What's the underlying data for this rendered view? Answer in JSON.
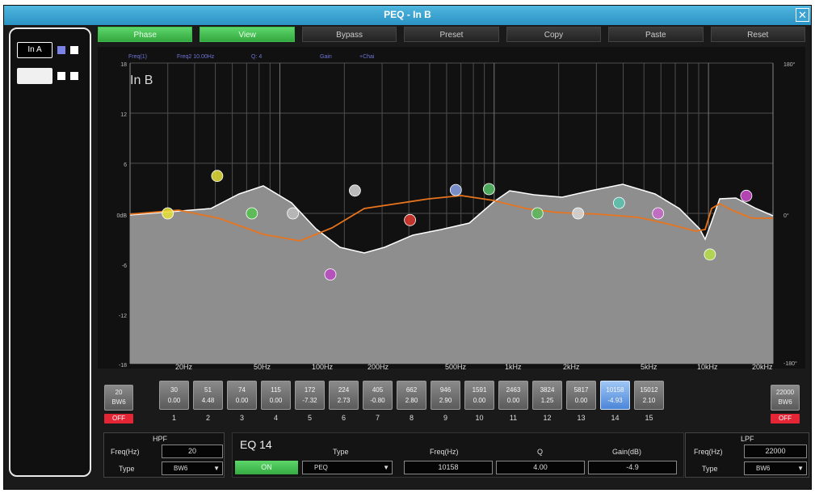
{
  "window": {
    "title": "PEQ - In B",
    "close_label": "✕"
  },
  "channels": [
    {
      "label": "In A",
      "color1": "#7b83e6",
      "color2": "#ffffff"
    },
    {
      "label": "In B",
      "color1": "#ffffff",
      "color2": "#ffffff"
    }
  ],
  "toolbar": {
    "buttons": [
      "Phase",
      "View",
      "Bypass",
      "Preset",
      "Copy",
      "Paste",
      "Reset"
    ],
    "active": [
      true,
      true,
      false,
      false,
      false,
      false,
      false
    ]
  },
  "graph": {
    "channel_name": "In B",
    "top_info": [
      "Freq(1)",
      "Freq2 10.00Hz",
      "Q: 4",
      "Gain",
      "+Chai"
    ],
    "y_ticks": [
      "18",
      "12",
      "6",
      "0dB",
      "-6",
      "-12",
      "-18"
    ],
    "right_ticks": [
      "180°",
      "0°",
      "-180°"
    ],
    "freq_labels": [
      "20Hz",
      "50Hz",
      "100Hz",
      "200Hz",
      "500Hz",
      "1kHz",
      "2kHz",
      "5kHz",
      "10kHz",
      "20kHz"
    ],
    "colors": {
      "fill": "#8e8e8e",
      "curve": "#ffffff",
      "phase": "#e8741e",
      "grid": "#5a5a5a",
      "bg": "#111111"
    }
  },
  "hpf_pass": {
    "value": "20",
    "type": "BW6",
    "off_label": "OFF"
  },
  "lpf_pass": {
    "value": "22000",
    "type": "BW6",
    "off_label": "OFF"
  },
  "bands": [
    {
      "num": "1",
      "freq": "30",
      "gain": "0.00"
    },
    {
      "num": "2",
      "freq": "51",
      "gain": "4.48"
    },
    {
      "num": "3",
      "freq": "74",
      "gain": "0.00"
    },
    {
      "num": "4",
      "freq": "115",
      "gain": "0.00"
    },
    {
      "num": "5",
      "freq": "172",
      "gain": "-7.32"
    },
    {
      "num": "6",
      "freq": "224",
      "gain": "2.73"
    },
    {
      "num": "7",
      "freq": "405",
      "gain": "-0.80"
    },
    {
      "num": "8",
      "freq": "662",
      "gain": "2.80"
    },
    {
      "num": "9",
      "freq": "946",
      "gain": "2.90"
    },
    {
      "num": "10",
      "freq": "1591",
      "gain": "0.00"
    },
    {
      "num": "11",
      "freq": "2463",
      "gain": "0.00"
    },
    {
      "num": "12",
      "freq": "3824",
      "gain": "1.25"
    },
    {
      "num": "13",
      "freq": "5817",
      "gain": "0.00"
    },
    {
      "num": "14",
      "freq": "10158",
      "gain": "-4.93",
      "selected": true
    },
    {
      "num": "15",
      "freq": "15012",
      "gain": "2.10"
    }
  ],
  "hpf": {
    "title": "HPF",
    "freq_label": "Freq(Hz)",
    "freq": "20",
    "type_label": "Type",
    "type": "BW6"
  },
  "lpf": {
    "title": "LPF",
    "freq_label": "Freq(Hz)",
    "freq": "22000",
    "type_label": "Type",
    "type": "BW6"
  },
  "eq": {
    "title": "EQ 14",
    "on_label": "ON",
    "type_label": "Type",
    "type": "PEQ",
    "freq_label": "Freq(Hz)",
    "freq": "10158",
    "q_label": "Q",
    "q": "4.00",
    "gain_label": "Gain(dB)",
    "gain": "-4.9"
  }
}
